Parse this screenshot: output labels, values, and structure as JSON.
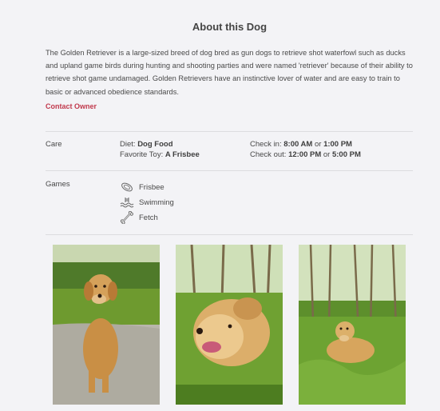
{
  "title": "About this Dog",
  "description": "The Golden Retriever is a large-sized breed of dog bred as gun dogs to retrieve shot waterfowl such as ducks and upland game birds during hunting and shooting parties and were named 'retriever' because of their ability to retrieve shot game undamaged. Golden Retrievers have an instinctive lover of water and are easy to train to basic or advanced obedience standards.",
  "contact_label": "Contact Owner",
  "care": {
    "label": "Care",
    "diet_label": "Diet:",
    "diet_value": "Dog Food",
    "toy_label": "Favorite Toy:",
    "toy_value": "A Frisbee",
    "checkin_label": "Check in:",
    "checkin_time1": "8:00 AM",
    "checkin_or": "or",
    "checkin_time2": "1:00 PM",
    "checkout_label": "Check out:",
    "checkout_time1": "12:00 PM",
    "checkout_or": "or",
    "checkout_time2": "5:00 PM"
  },
  "games": {
    "label": "Games",
    "items": [
      {
        "label": "Frisbee",
        "icon": "frisbee-icon"
      },
      {
        "label": "Swimming",
        "icon": "swimming-icon"
      },
      {
        "label": "Fetch",
        "icon": "bone-icon"
      }
    ]
  },
  "photos": [
    {
      "name": "dog-photo-sitting"
    },
    {
      "name": "dog-photo-closeup"
    },
    {
      "name": "dog-photo-lying"
    }
  ],
  "colors": {
    "background": "#f3f3f6",
    "accent": "#c13a4d",
    "text": "#484848",
    "divider": "#dcdcdf"
  }
}
